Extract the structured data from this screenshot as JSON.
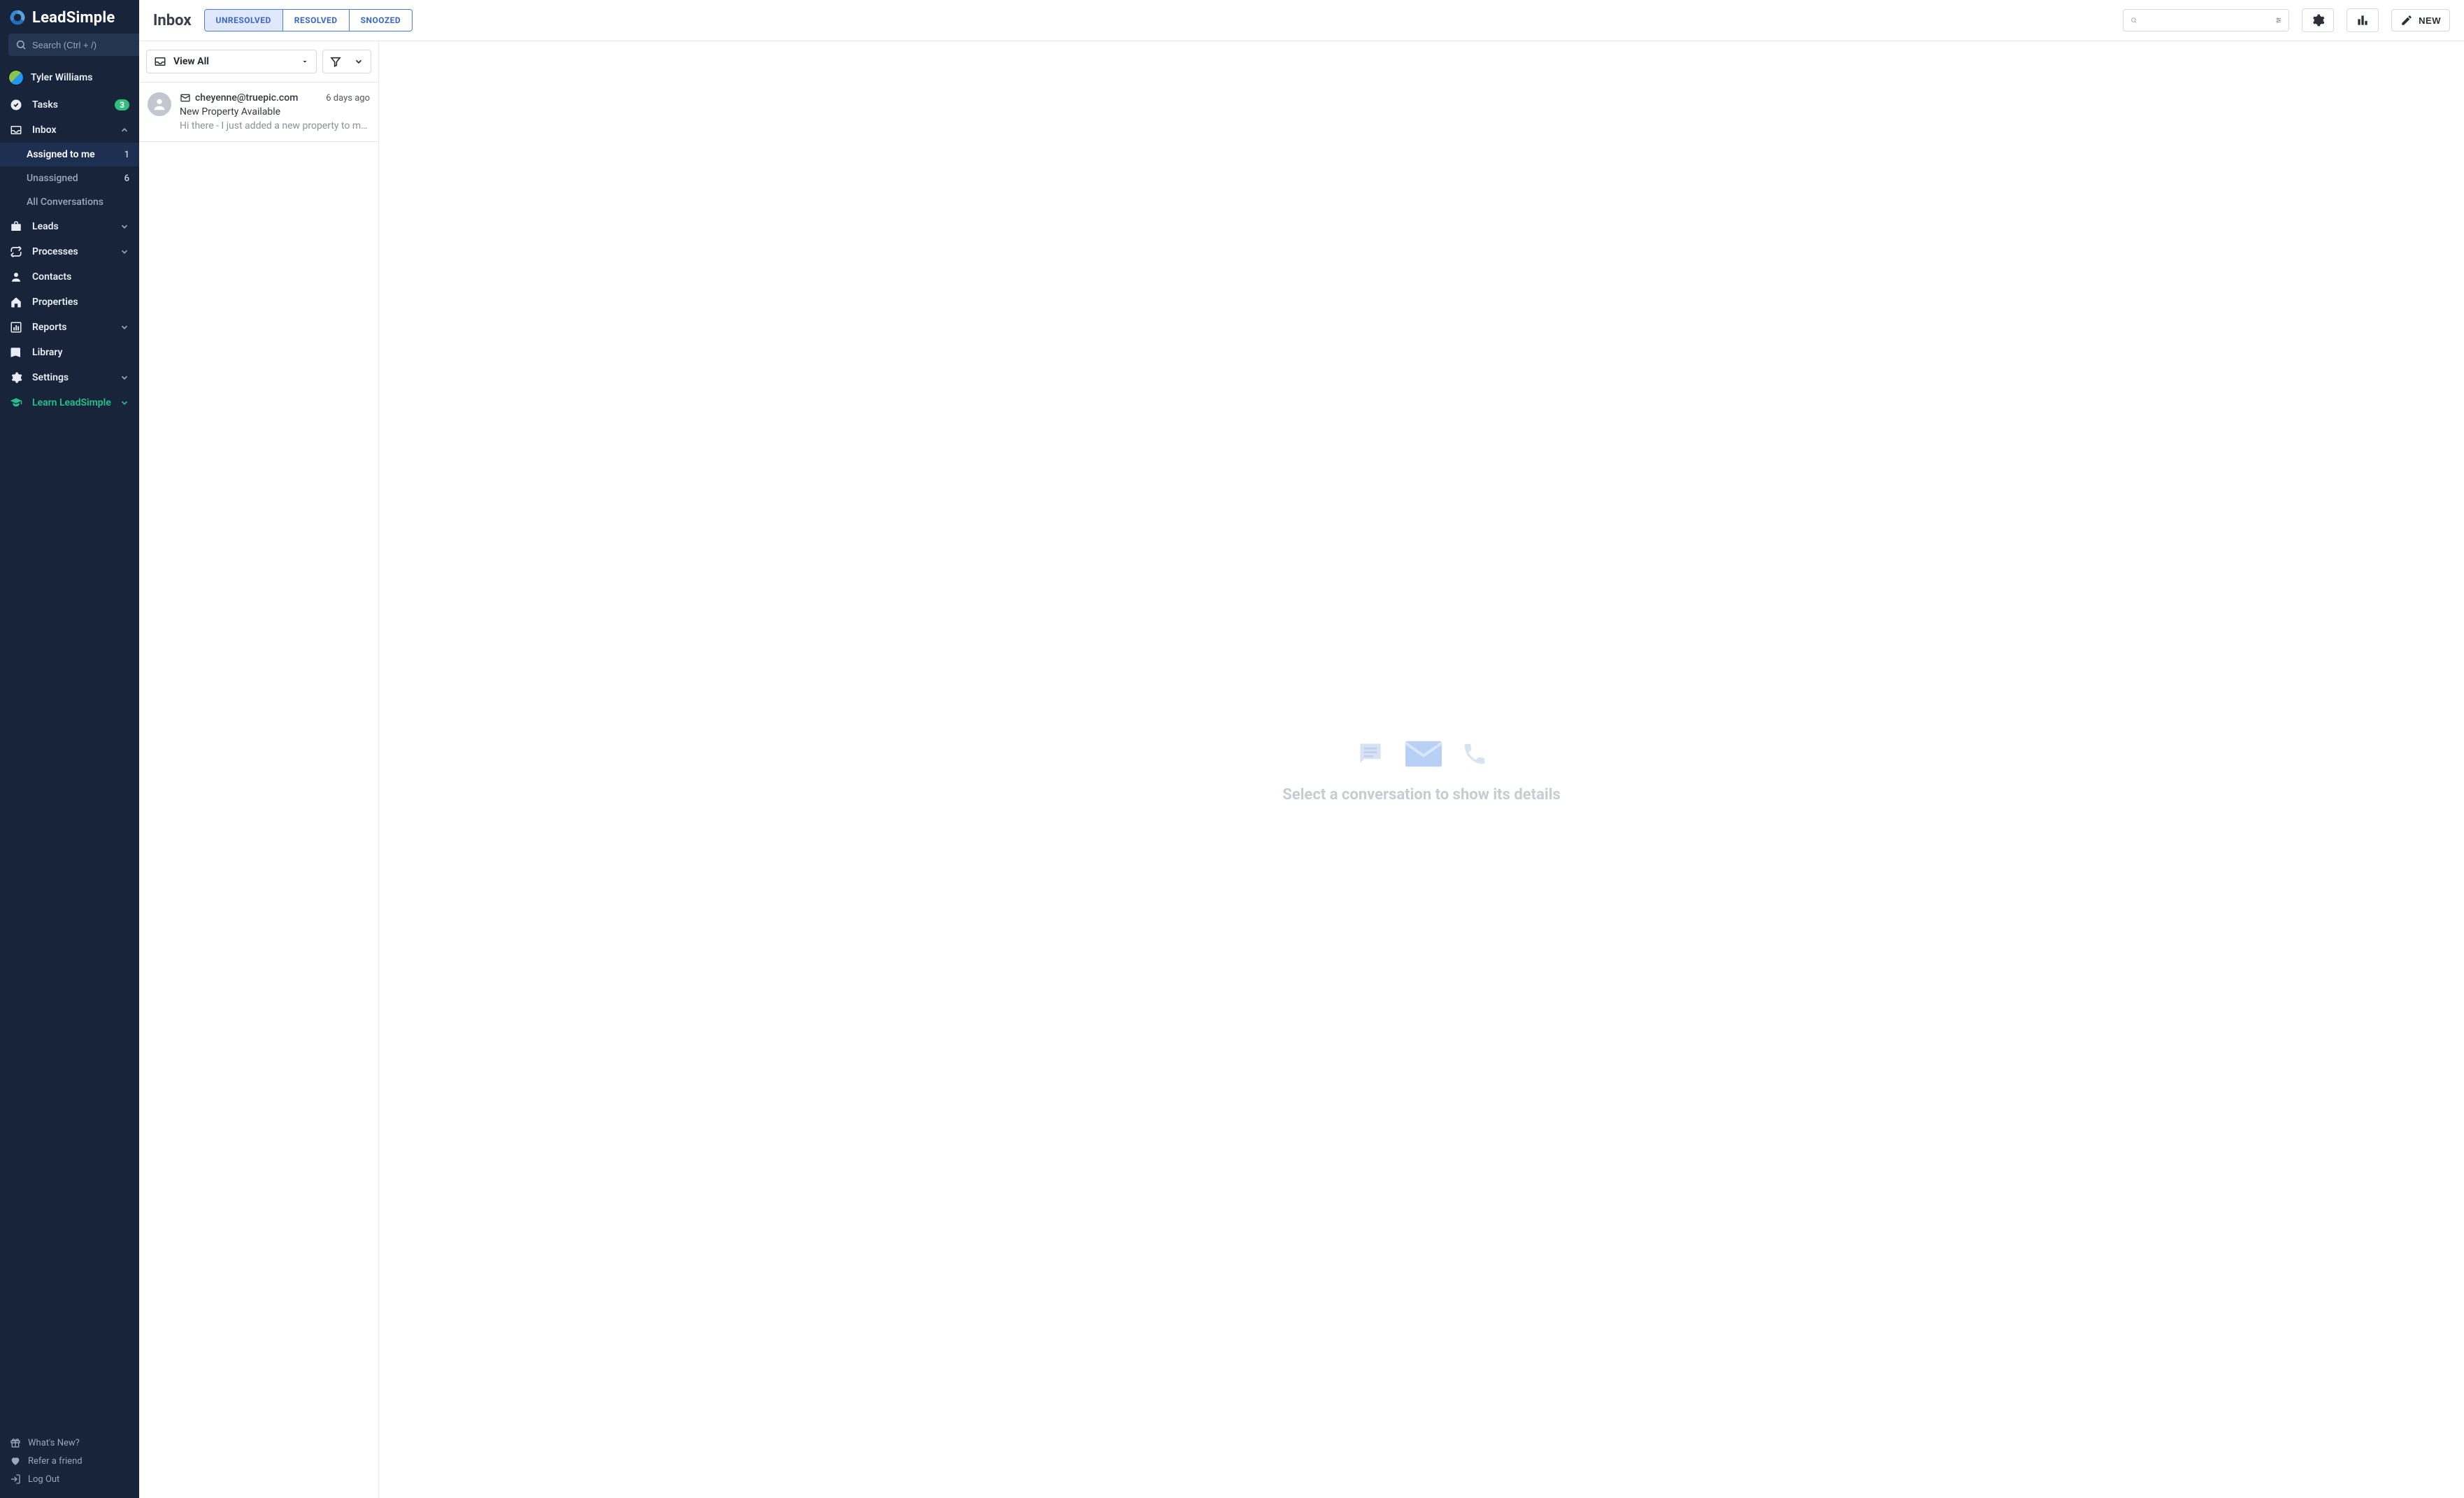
{
  "brand": {
    "name": "LeadSimple"
  },
  "sidebar": {
    "search_placeholder": "Search (Ctrl + /)",
    "user_name": "Tyler Williams",
    "tasks": {
      "label": "Tasks",
      "badge": "3"
    },
    "inbox": {
      "label": "Inbox",
      "sub": {
        "assigned": {
          "label": "Assigned to me",
          "count": "1"
        },
        "unassigned": {
          "label": "Unassigned",
          "count": "6"
        },
        "all": {
          "label": "All Conversations"
        }
      }
    },
    "leads": "Leads",
    "processes": "Processes",
    "contacts": "Contacts",
    "properties": "Properties",
    "reports": "Reports",
    "library": "Library",
    "settings": "Settings",
    "learn": "Learn LeadSimple",
    "footer": {
      "whatsnew": "What's New?",
      "refer": "Refer a friend",
      "logout": "Log Out"
    }
  },
  "header": {
    "title": "Inbox",
    "tabs": {
      "unresolved": "UNRESOLVED",
      "resolved": "RESOLVED",
      "snoozed": "SNOOZED"
    },
    "new_label": "NEW"
  },
  "list_toolbar": {
    "view_label": "View All"
  },
  "conversations": [
    {
      "from": "cheyenne@truepic.com",
      "time": "6 days ago",
      "subject": "New Property Available",
      "preview": "Hi there - I just added a new property to my portfo..."
    }
  ],
  "empty_state": "Select a conversation to show its details"
}
